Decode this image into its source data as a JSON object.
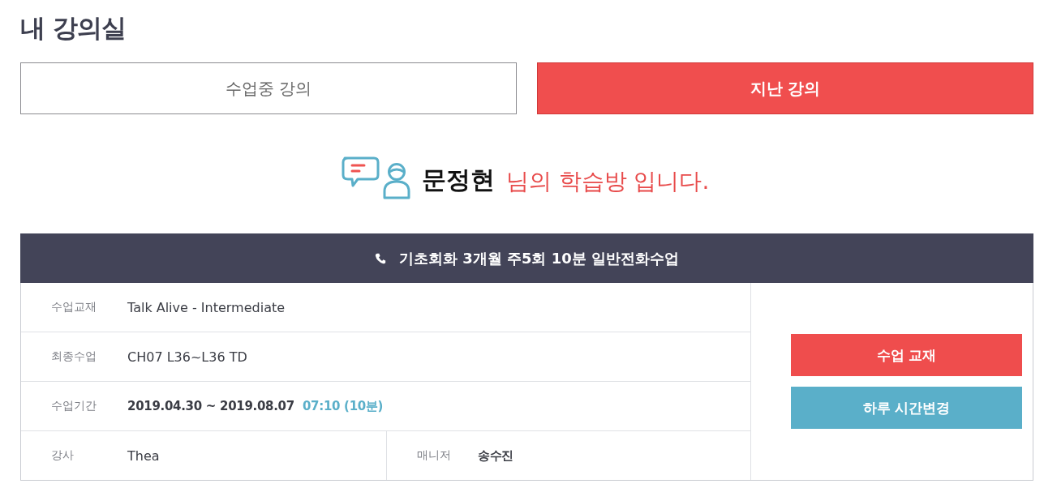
{
  "page": {
    "title": "내 강의실"
  },
  "tabs": [
    {
      "label": "수업중 강의",
      "selected": false
    },
    {
      "label": "지난 강의",
      "selected": true
    }
  ],
  "greeting": {
    "name": "문정현",
    "message": "님의 학습방 입니다."
  },
  "course": {
    "title": "기초회화 3개월 주5회 10분 일반전화수업",
    "rows": [
      {
        "kind": "single",
        "fields": [
          {
            "label": "수업교재",
            "value": "Talk Alive - Intermediate",
            "bold": false
          }
        ]
      },
      {
        "kind": "single",
        "fields": [
          {
            "label": "최종수업",
            "value": "CH07 L36~L36 TD",
            "bold": false
          }
        ]
      },
      {
        "kind": "single",
        "fields": [
          {
            "label": "수업기간",
            "value": "2019.04.30 ~ 2019.08.07",
            "note": "07:10 (10분)",
            "bold": true
          }
        ]
      },
      {
        "kind": "split",
        "fields": [
          {
            "label": "강사",
            "value": "Thea",
            "bold": false
          },
          {
            "label": "매니저",
            "value": "송수진",
            "bold": true
          }
        ]
      }
    ],
    "actions": [
      {
        "label": "수업 교재",
        "kind": "primary"
      },
      {
        "label": "하루 시간변경",
        "kind": "secondary"
      }
    ]
  }
}
